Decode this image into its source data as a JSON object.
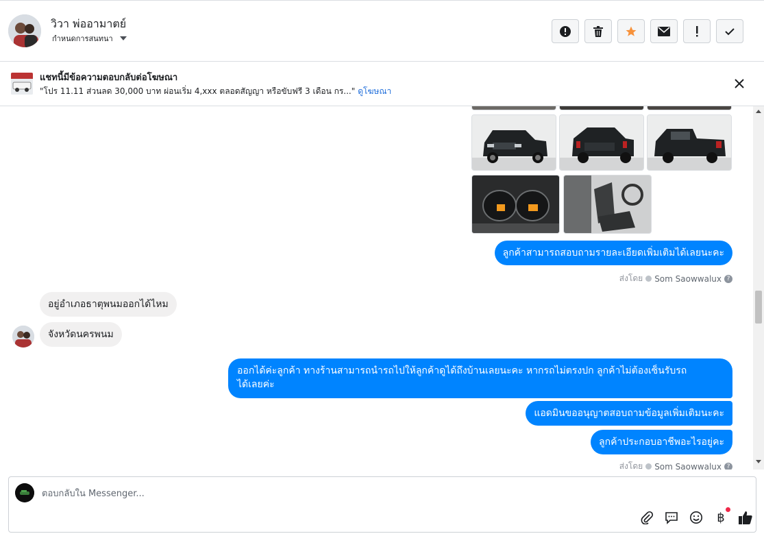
{
  "header": {
    "contact_name": "วิวา พ่ออามาตย์",
    "subtitle": "กำหนดการสนทนา",
    "actions": [
      "mark-spam",
      "delete",
      "star",
      "mark-unread",
      "follow-up",
      "mark-done"
    ]
  },
  "ad_banner": {
    "title": "แชทนี้มีข้อความตอบกลับต่อโฆษณา",
    "text": "\"โปร 11.11 ส่วนลด 30,000 บาท ผ่อนเริ่ม 4,xxx ตลอดสัญญา หรือขับฟรี 3 เดือน กร...\"",
    "link": "ดูโฆษณา"
  },
  "messages": {
    "out_1": "ลูกค้าสามารถสอบถามรายละเอียดเพิ่มเติมได้เลยนะคะ",
    "sent_by_label": "ส่งโดย",
    "sent_by_name": "Som Saowwalux",
    "in_1": "อยู่อำเภอธาตุพนมออกได้ไหม",
    "in_2": "จังหวัดนครพนม",
    "out_2_line1": "ออกได้ค่ะลูกค้า ทางร้านสามารถนำรถไปให้ลูกค้าดูได้ถึงบ้านเลยนะคะ หากรถไม่ตรงปก ลูกค้าไม่ต้องเซ็นรับรถ",
    "out_2_line2": "ได้เลยค่ะ",
    "out_3": "แอดมินขออนุญาตสอบถามข้อมูลเพิ่มเติมนะคะ",
    "out_4": "ลูกค้าประกอบอาชีพอะไรอยู่คะ",
    "sent_by_2_label": "ส่งโดย",
    "sent_by_2_name": "Som Saowwalux"
  },
  "composer": {
    "placeholder": "ตอบกลับใน Messenger...",
    "tools": [
      "attach-icon",
      "saved-replies-icon",
      "emoji-icon",
      "payment-icon",
      "like-icon"
    ],
    "currency_symbol": "฿"
  },
  "colors": {
    "outgoing_bubble": "#0084ff",
    "incoming_bubble": "#f1f0f0",
    "star": "#f7923b",
    "link": "#216fdb"
  }
}
